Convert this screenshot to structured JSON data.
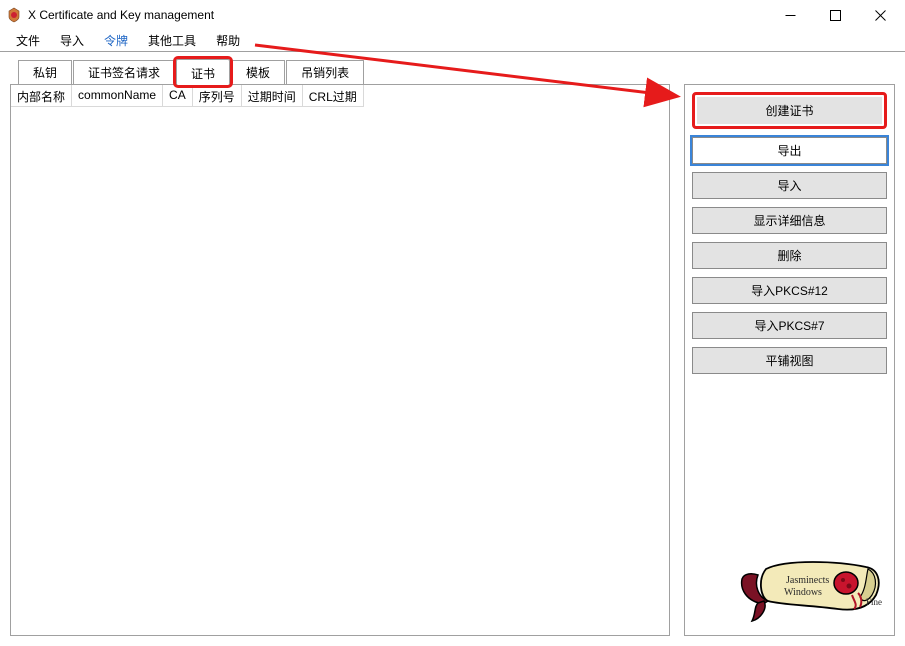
{
  "window": {
    "title": "X Certificate and Key management"
  },
  "menu": {
    "file": "文件",
    "import": "导入",
    "token": "令牌",
    "tools": "其他工具",
    "help": "帮助"
  },
  "tabs": {
    "private_keys": "私钥",
    "csr": "证书签名请求",
    "certificates": "证书",
    "templates": "模板",
    "revocation": "吊销列表",
    "active": "certificates"
  },
  "columns": {
    "internal_name": "内部名称",
    "common_name": "commonName",
    "ca": "CA",
    "serial": "序列号",
    "expiry": "过期时间",
    "crl_expiry": "CRL过期"
  },
  "buttons": {
    "new_cert": "创建证书",
    "export": "导出",
    "import": "导入",
    "show_details": "显示详细信息",
    "delete": "删除",
    "import_pkcs12": "导入PKCS#12",
    "import_pkcs7": "导入PKCS#7",
    "flat_view": "平铺视图"
  }
}
